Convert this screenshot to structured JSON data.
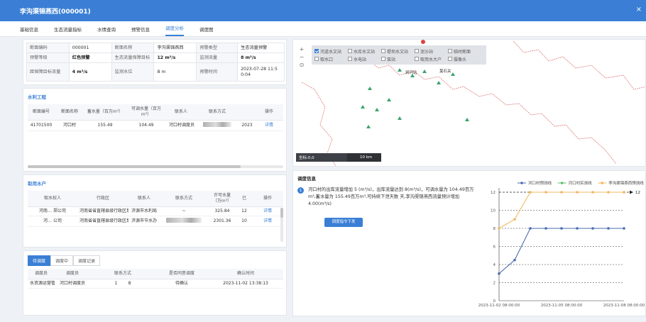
{
  "window": {
    "title": "李沟渠锦燕西(000001)",
    "close": "×"
  },
  "tabs": [
    "基础信息",
    "生态流量指标",
    "水情查询",
    "预警信息",
    "调度分析",
    "调度图"
  ],
  "info": {
    "section_code_label": "断面编码",
    "section_code": "000001",
    "section_name_label": "断面名称",
    "section_name": "李沟渠锦燕西",
    "warn_type_label": "预警类型",
    "warn_type": "生态流量预警",
    "warn_level_label": "预警等级",
    "warn_level": "红色预警",
    "target_label": "生态流量保障目标",
    "target": "12 m³/s",
    "flow_label": "监测流量",
    "flow": "8 m³/s",
    "gap_label": "距保障目标流量",
    "gap": "4 m³/s",
    "level_label": "监测水位",
    "level": "8 m",
    "time_label": "预警时间",
    "time_1": "2023-07-28 11:5",
    "time_2": "0:04"
  },
  "projects": {
    "title": "水利工程",
    "headers": [
      "断面编号",
      "断面名称",
      "蓄水量（百万m³）",
      "可调水量（百万m³）",
      "联系人",
      "联系方式",
      "",
      "操作"
    ],
    "row": {
      "code": "41701500",
      "name": "河口村",
      "storage": "155.49",
      "adjustable": "104.49",
      "contact": "河口村调度员",
      "extra": "2023",
      "action": "详情"
    }
  },
  "users": {
    "title": "取用水户",
    "headers": [
      "取水权人",
      "行政区",
      "联系人",
      "联系方式",
      "许可水量（万m³）",
      "已",
      "操作"
    ],
    "rows": [
      {
        "owner": "河南… 郑公司",
        "region": "河南省省直辖县级行政区划",
        "contact": "济源市水利局",
        "phone": "~",
        "amount": "325.84",
        "used": "12",
        "action": "详情"
      },
      {
        "owner": "河… 公司",
        "region": "河南省省直辖县级行政区划",
        "contact": "济源市节水办",
        "phone": "",
        "amount": "2301.36",
        "used": "10",
        "action": "详情"
      }
    ]
  },
  "schedule": {
    "tabs": [
      "待调度",
      "调度中",
      "调度记录"
    ],
    "headers": [
      "调度员",
      "调度员",
      "联系方式",
      "是否同意调度",
      "确认时间"
    ],
    "row": {
      "unit": "水资源运营管理中心",
      "dispatcher": "河口村调度员",
      "phone_a": "1",
      "phone_b": "8",
      "status": "待确认",
      "time": "2023-11-02 13:38:13"
    }
  },
  "map": {
    "zoom": [
      "+",
      "−",
      "⊙"
    ],
    "legend": [
      {
        "label": "河道水文站",
        "checked": true
      },
      {
        "label": "水库水文站",
        "checked": false
      },
      {
        "label": "堤坝水文站",
        "checked": false
      },
      {
        "label": "泥沙站",
        "checked": false
      },
      {
        "label": "临时断面",
        "checked": false
      },
      {
        "label": "取水口",
        "checked": false
      },
      {
        "label": "水电站",
        "checked": false
      },
      {
        "label": "泵站",
        "checked": false
      },
      {
        "label": "取用水大户",
        "checked": false
      },
      {
        "label": "摄像头",
        "checked": false
      }
    ],
    "places": [
      "涧河站",
      "莫石关"
    ],
    "coords": "坐标:0,0",
    "scale": "10 km"
  },
  "dispatch": {
    "title": "调度信息",
    "index": "1",
    "message": "河口村的出库流量增加 5 (m³/s)，出库流量达到 8(m³/s)，可调水量为 104.49百万m³,蓄水量为 155.49百万m³,可持续下泄天数 天,李沟渠锦燕西流量预计增加4.00(m³/s)",
    "button": "调度指令下发"
  },
  "chart_data": {
    "type": "line",
    "x_ticks": [
      {
        "index": 0,
        "label": "2023-11-02 08:00:00"
      },
      {
        "index": 4,
        "label": "2023-11-05 08:00:00"
      },
      {
        "index": 8,
        "label": "2023-11-08 08:00:00"
      }
    ],
    "series": [
      {
        "name": "河口村预测线",
        "color": "#4a6bb0",
        "values": [
          3,
          4.5,
          8,
          8,
          8,
          8,
          8,
          8,
          8
        ]
      },
      {
        "name": "河口村实测线",
        "color": "#5bbf6a",
        "values": []
      },
      {
        "name": "李沟渠锦燕西预测线",
        "color": "#f0b860",
        "values": [
          8,
          9,
          12,
          12,
          12,
          12,
          12,
          12,
          12
        ]
      }
    ],
    "ylim": [
      0,
      12
    ],
    "yticks": [
      0,
      2,
      4,
      6,
      8,
      10,
      12
    ],
    "target_line": {
      "value": 12,
      "label": "12"
    },
    "grid": true,
    "legend_position": "top"
  }
}
